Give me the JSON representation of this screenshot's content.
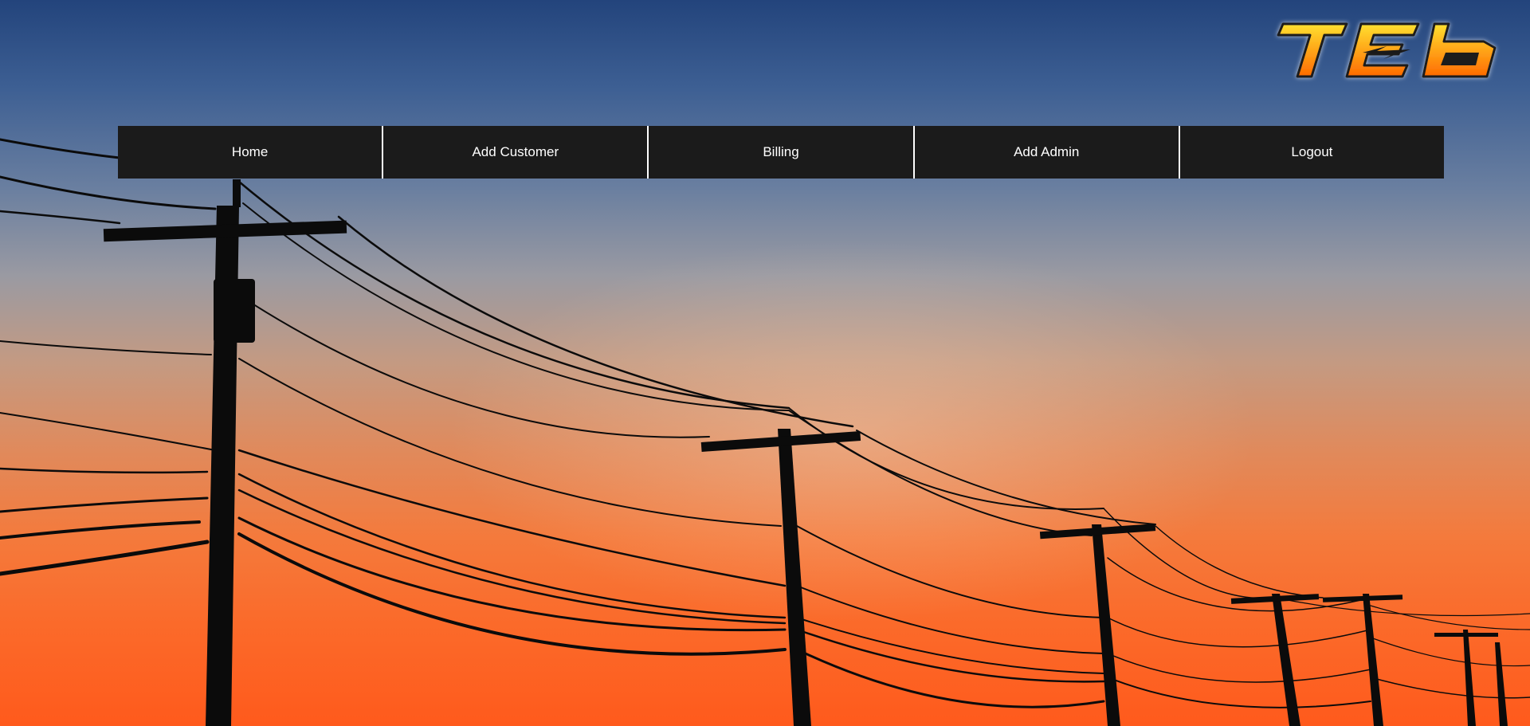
{
  "brand": {
    "logo_text": "TEb",
    "colors": {
      "logo_fill_top": "#ffd21a",
      "logo_fill_bottom": "#ff6a00",
      "logo_outline": "#1a1a1a"
    }
  },
  "nav": {
    "items": [
      {
        "label": "Home"
      },
      {
        "label": "Add Customer"
      },
      {
        "label": "Billing"
      },
      {
        "label": "Add Admin"
      },
      {
        "label": "Logout"
      }
    ]
  },
  "theme": {
    "nav_background": "#1b1b1b",
    "nav_text": "#ffffff",
    "background_image": "power-lines-sunset"
  }
}
